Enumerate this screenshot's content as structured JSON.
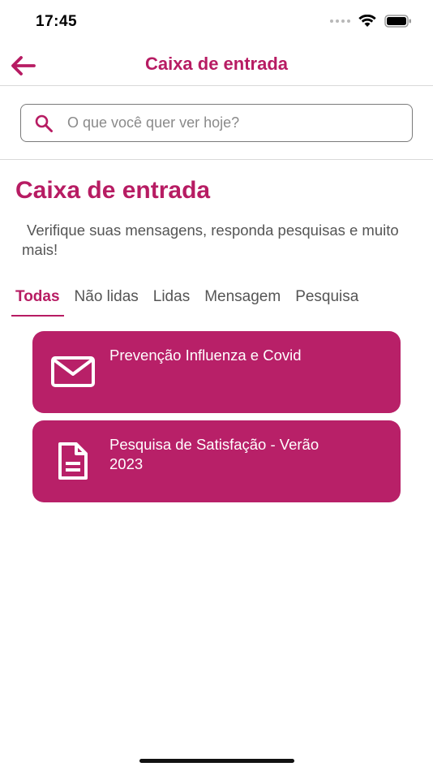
{
  "status_bar": {
    "time": "17:45"
  },
  "header": {
    "title": "Caixa de entrada",
    "back_icon": "arrow-left-icon"
  },
  "search": {
    "placeholder": "O que você quer ver hoje?",
    "value": "",
    "icon": "search-icon"
  },
  "main": {
    "title": "Caixa de entrada",
    "description": "Verifique suas mensagens, responda pesquisas e muito mais!"
  },
  "tabs": [
    {
      "label": "Todas",
      "active": true
    },
    {
      "label": "Não lidas",
      "active": false
    },
    {
      "label": "Lidas",
      "active": false
    },
    {
      "label": "Mensagem",
      "active": false
    },
    {
      "label": "Pesquisa",
      "active": false
    }
  ],
  "messages": [
    {
      "title": "Prevenção Influenza e Covid",
      "icon": "envelope-icon"
    },
    {
      "title": "Pesquisa de Satisfação - Verão 2023",
      "icon": "document-icon"
    }
  ],
  "colors": {
    "accent": "#b71c63",
    "card_background": "#b82068",
    "text": "#555555"
  }
}
